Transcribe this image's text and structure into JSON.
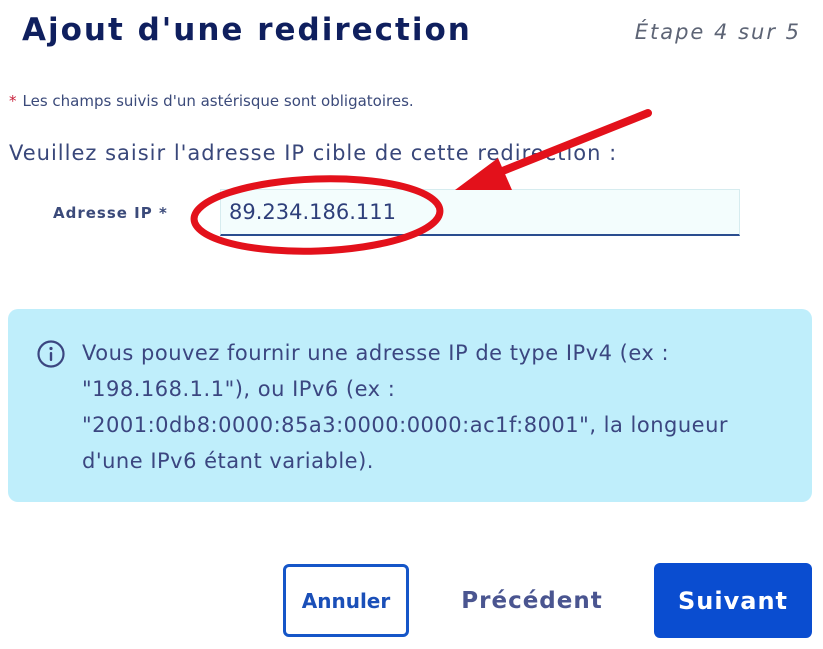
{
  "header": {
    "title": "Ajout d'une redirection",
    "step": "Étape 4 sur 5"
  },
  "form": {
    "required_star": "*",
    "required_note": "Les champs suivis d'un astérisque sont obligatoires.",
    "prompt": "Veuillez saisir l'adresse IP cible de cette redirection :",
    "ip_label": "Adresse IP *",
    "ip_value": "89.234.186.111"
  },
  "info": {
    "icon": "info-circle-icon",
    "text": "Vous pouvez fournir une adresse IP de type IPv4 (ex : \"198.168.1.1\"), ou IPv6 (ex : \"2001:0db8:0000:85a3:0000:0000:ac1f:8001\", la longueur d'une IPv6 étant variable)."
  },
  "buttons": {
    "cancel": "Annuler",
    "previous": "Précédent",
    "next": "Suivant"
  },
  "colors": {
    "title": "#0f1f5e",
    "info_background": "#bfeefb",
    "primary": "#0a4dd0",
    "annotation": "#e3111b"
  }
}
